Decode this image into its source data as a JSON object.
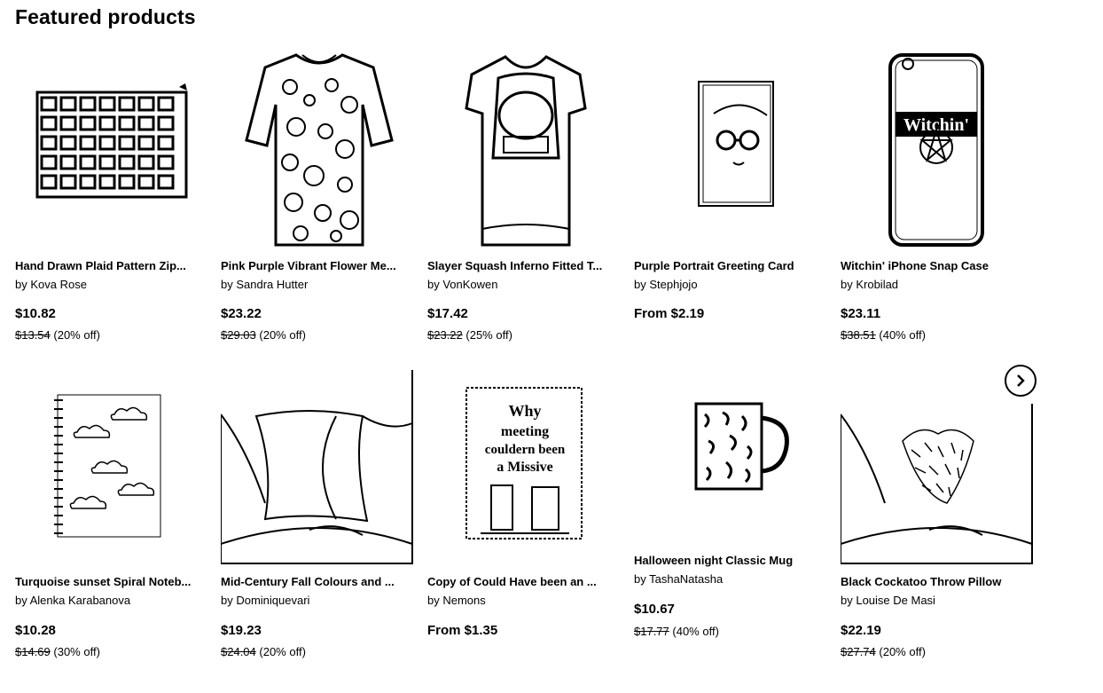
{
  "header": {
    "title": "Featured products"
  },
  "products": [
    {
      "title": "Hand Drawn Plaid Pattern Zip...",
      "by": "by Kova Rose",
      "price": "$10.82",
      "orig_price": "$13.54",
      "discount": "(20% off)"
    },
    {
      "title": "Pink Purple Vibrant Flower Me...",
      "by": "by Sandra Hutter",
      "price": "$23.22",
      "orig_price": "$29.03",
      "discount": "(20% off)"
    },
    {
      "title": "Slayer Squash Inferno Fitted T...",
      "by": "by VonKowen",
      "price": "$17.42",
      "orig_price": "$23.22",
      "discount": "(25% off)"
    },
    {
      "title": "Purple Portrait Greeting Card",
      "by": "by Stephjojo",
      "price": "From $2.19",
      "orig_price": "",
      "discount": ""
    },
    {
      "title": "Witchin' iPhone Snap Case",
      "by": "by Krobilad",
      "price": "$23.11",
      "orig_price": "$38.51",
      "discount": "(40% off)"
    },
    {
      "title": "Turquoise sunset Spiral Noteb...",
      "by": "by Alenka Karabanova",
      "price": "$10.28",
      "orig_price": "$14.69",
      "discount": "(30% off)"
    },
    {
      "title": "Mid-Century Fall Colours and ...",
      "by": "by Dominiquevari",
      "price": "$19.23",
      "orig_price": "$24.04",
      "discount": "(20% off)"
    },
    {
      "title": "Copy of Could Have been an ...",
      "by": "by Nemons",
      "price": "From $1.35",
      "orig_price": "",
      "discount": ""
    },
    {
      "title": "Halloween night Classic Mug",
      "by": "by TashaNatasha",
      "price": "$10.67",
      "orig_price": "$17.77",
      "discount": "(40% off)"
    },
    {
      "title": "Black Cockatoo Throw Pillow",
      "by": "by Louise De Masi",
      "price": "$22.19",
      "orig_price": "$27.74",
      "discount": "(20% off)"
    }
  ],
  "thumb_text": {
    "phone_case": "Witchin'",
    "poster_line1": "Why",
    "poster_line2": "meeting",
    "poster_line3": "couldern been",
    "poster_line4": "a Missive"
  },
  "icons": {
    "next": "chevron-right-icon"
  }
}
